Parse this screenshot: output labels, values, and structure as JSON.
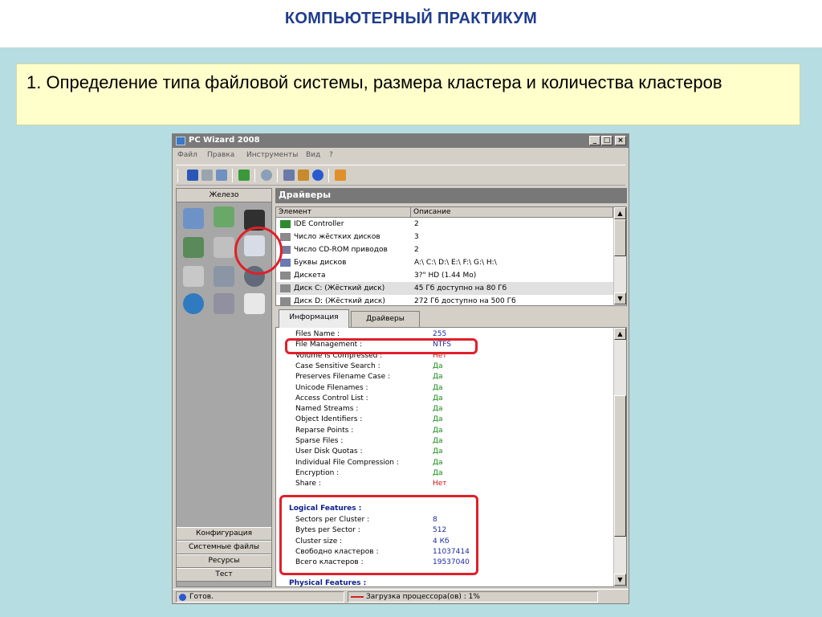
{
  "slide": {
    "title": "КОМПЬЮТЕРНЫЙ ПРАКТИКУМ",
    "caption": "1. Определение типа файловой системы, размера кластера и количества кластеров"
  },
  "window": {
    "title": "PC Wizard 2008",
    "controls": [
      "_",
      "□",
      "×"
    ],
    "menu": [
      "Файл",
      "Правка",
      "Инструменты",
      "Вид",
      "?"
    ]
  },
  "left_panel": {
    "header": "Железо",
    "buttons": [
      "Конфигурация",
      "Системные файлы",
      "Ресурсы",
      "Тест"
    ]
  },
  "drivers": {
    "header": "Драйверы",
    "columns": [
      "Элемент",
      "Описание"
    ],
    "rows": [
      {
        "element": "IDE Controller",
        "desc": "2"
      },
      {
        "element": "Число жёстких дисков",
        "desc": "3"
      },
      {
        "element": "Число CD-ROM приводов",
        "desc": "2"
      },
      {
        "element": "Буквы дисков",
        "desc": "A:\\ C:\\ D:\\ E:\\ F:\\ G:\\ H:\\"
      },
      {
        "element": "Дискета",
        "desc": "3?\" HD (1.44 Mo)"
      },
      {
        "element": "Диск C: (Жёсткий диск)",
        "desc": "45 Гб доступно на 80 Гб"
      },
      {
        "element": "Диск D: (Жёсткий диск)",
        "desc": "272 Гб доступно на 500 Гб"
      }
    ]
  },
  "tabs": [
    "Информация",
    "Драйверы"
  ],
  "info": {
    "rows": [
      {
        "label": "Files Name :",
        "value": "255",
        "color": "#1a2aa0"
      },
      {
        "label": "File Management :",
        "value": "NTFS",
        "color": "#1a2aa0"
      },
      {
        "label": "Volume is Compressed :",
        "value": "Нет",
        "color": "#d01010"
      },
      {
        "label": "Case Sensitive Search :",
        "value": "Да",
        "color": "#128a12"
      },
      {
        "label": "Preserves Filename Case :",
        "value": "Да",
        "color": "#128a12"
      },
      {
        "label": "Unicode Filenames :",
        "value": "Да",
        "color": "#128a12"
      },
      {
        "label": "Access Control List :",
        "value": "Да",
        "color": "#128a12"
      },
      {
        "label": "Named Streams :",
        "value": "Да",
        "color": "#128a12"
      },
      {
        "label": "Object Identifiers :",
        "value": "Да",
        "color": "#128a12"
      },
      {
        "label": "Reparse Points :",
        "value": "Да",
        "color": "#128a12"
      },
      {
        "label": "Sparse Files :",
        "value": "Да",
        "color": "#128a12"
      },
      {
        "label": "User Disk Quotas :",
        "value": "Да",
        "color": "#128a12"
      },
      {
        "label": "Individual File Compression :",
        "value": "Да",
        "color": "#128a12"
      },
      {
        "label": "Encryption :",
        "value": "Да",
        "color": "#128a12"
      },
      {
        "label": "Share :",
        "value": "Нет",
        "color": "#d01010"
      }
    ],
    "logical_title": "Logical Features :",
    "logical_rows": [
      {
        "label": "Sectors per Cluster :",
        "value": "8"
      },
      {
        "label": "Bytes per Sector :",
        "value": "512"
      },
      {
        "label": "Cluster size :",
        "value": "4 Кб"
      },
      {
        "label": "Свободно кластеров :",
        "value": "11037414"
      },
      {
        "label": "Всего кластеров :",
        "value": "19537040"
      }
    ],
    "physical_title": "Physical Features :"
  },
  "status": {
    "ready": "Готов.",
    "cpu": "Загрузка процессора(ов) : 1%"
  },
  "colors": {
    "highlight": "#e0202a",
    "value_blue": "#1a2aa0",
    "value_green": "#128a12",
    "value_red": "#d01010"
  }
}
